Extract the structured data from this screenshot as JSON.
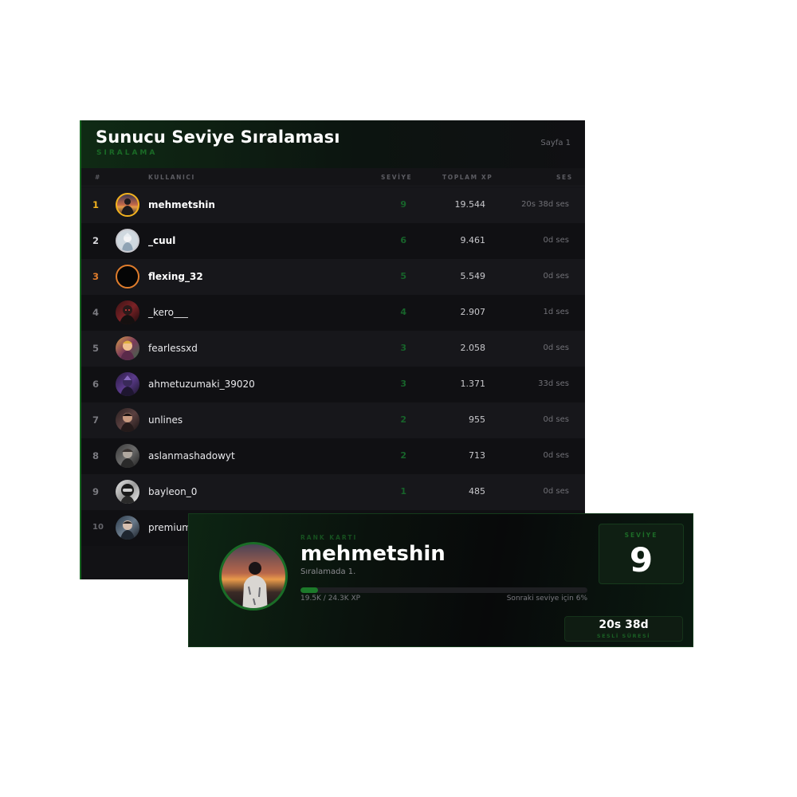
{
  "leaderboard": {
    "title": "Sunucu Seviye Sıralaması",
    "subtitle": "SIRALAMA",
    "page": "Sayfa 1",
    "columns": {
      "rank": "#",
      "user": "KULLANICI",
      "level": "SEVİYE",
      "xp": "TOPLAM XP",
      "voice": "SES"
    },
    "rows": [
      {
        "rank": "1",
        "name": "mehmetshin",
        "level": "9",
        "xp": "19.544",
        "voice": "20s 38d ses"
      },
      {
        "rank": "2",
        "name": "_cuul",
        "level": "6",
        "xp": "9.461",
        "voice": "0d ses"
      },
      {
        "rank": "3",
        "name": "flexing_32",
        "level": "5",
        "xp": "5.549",
        "voice": "0d ses"
      },
      {
        "rank": "4",
        "name": "_kero___",
        "level": "4",
        "xp": "2.907",
        "voice": "1d ses"
      },
      {
        "rank": "5",
        "name": "fearlessxd",
        "level": "3",
        "xp": "2.058",
        "voice": "0d ses"
      },
      {
        "rank": "6",
        "name": "ahmetuzumaki_39020",
        "level": "3",
        "xp": "1.371",
        "voice": "33d ses"
      },
      {
        "rank": "7",
        "name": "unlines",
        "level": "2",
        "xp": "955",
        "voice": "0d ses"
      },
      {
        "rank": "8",
        "name": "aslanmashadowyt",
        "level": "2",
        "xp": "713",
        "voice": "0d ses"
      },
      {
        "rank": "9",
        "name": "bayleon_0",
        "level": "1",
        "xp": "485",
        "voice": "0d ses"
      },
      {
        "rank": "10",
        "name": "premiumt"
      }
    ]
  },
  "rank_card": {
    "tag": "RANK KARTI",
    "username": "mehmetshin",
    "position": "Sıralamada 1.",
    "xp_progress": "19.5K / 24.3K XP",
    "next_level": "Sonraki seviye için 6%",
    "progress_fraction": 0.06,
    "level_label": "SEVİYE",
    "level_value": "9",
    "voice_value": "20s 38d",
    "voice_label": "SESLİ SÜRESİ"
  },
  "colors": {
    "accent_green": "#1c7a2a",
    "gold": "#f2b21e",
    "silver": "#c9c9cf",
    "bronze": "#e07d2c"
  }
}
